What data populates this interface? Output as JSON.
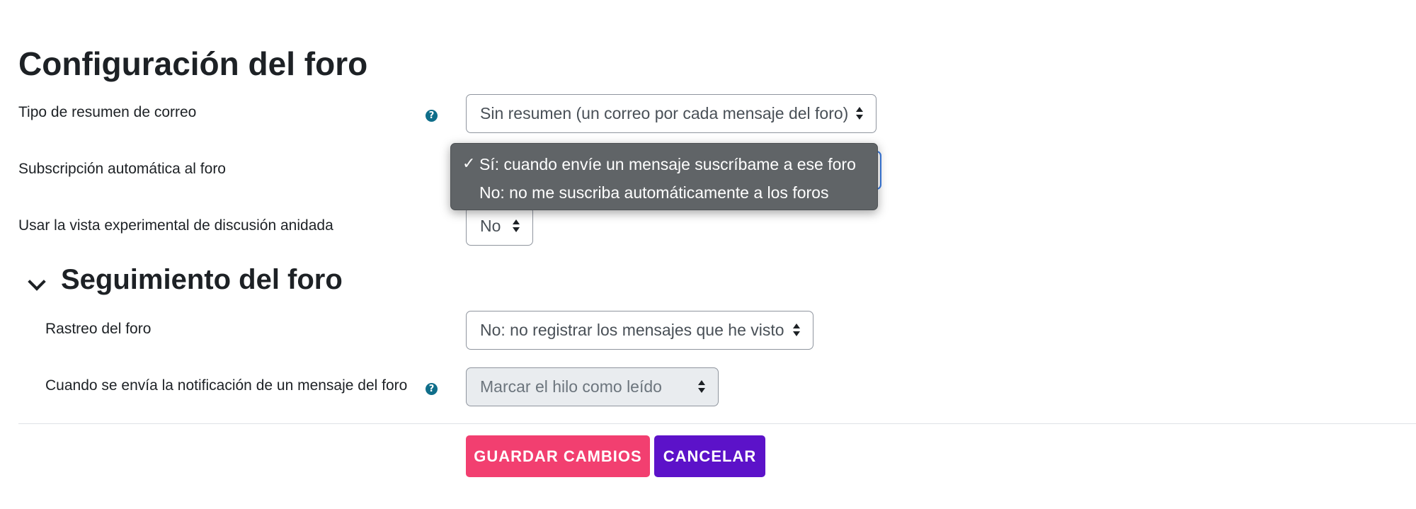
{
  "page": {
    "title": "Configuración del foro"
  },
  "fields": {
    "digest": {
      "label": "Tipo de resumen de correo",
      "value": "Sin resumen (un correo por cada mensaje del foro)"
    },
    "autosubscribe": {
      "label": "Subscripción automática al foro",
      "options": [
        "Sí: cuando envíe un mensaje suscríbame a ese foro",
        "No: no me suscriba automáticamente a los foros"
      ],
      "selected_index": 0,
      "check_mark": "✓"
    },
    "nested_view": {
      "label": "Usar la vista experimental de discusión anidada",
      "value": "No"
    }
  },
  "tracking": {
    "title": "Seguimiento del foro",
    "tracking_field": {
      "label": "Rastreo del foro",
      "value": "No: no registrar los mensajes que he visto"
    },
    "notification_field": {
      "label": "Cuando se envía la notificación de un mensaje del foro",
      "value": "Marcar el hilo como leído"
    }
  },
  "actions": {
    "save_label": "GUARDAR CAMBIOS",
    "cancel_label": "CANCELAR"
  },
  "icons": {
    "help": "question-circle-icon",
    "chevron": "chevron-down-icon",
    "select_arrows": "sort-arrows-icon"
  },
  "colors": {
    "save_button": "#f23f70",
    "cancel_button": "#5c12c9",
    "help_icon": "#0f6e8a",
    "dropdown_bg": "#606467"
  }
}
